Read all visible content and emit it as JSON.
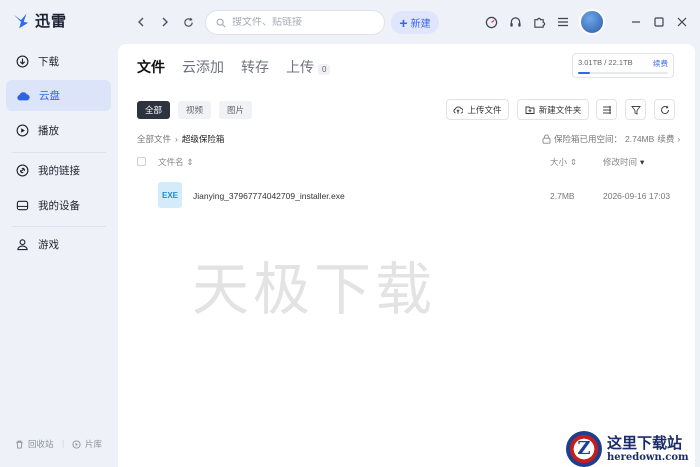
{
  "app": {
    "name": "迅雷"
  },
  "search": {
    "placeholder": "搜文件、贴链接"
  },
  "toolbar": {
    "new_label": "新建"
  },
  "sidebar": {
    "items": [
      {
        "label": "下载",
        "icon": "download-icon"
      },
      {
        "label": "云盘",
        "icon": "cloud-icon"
      },
      {
        "label": "播放",
        "icon": "play-icon"
      },
      {
        "label": "我的链接",
        "icon": "link-icon"
      },
      {
        "label": "我的设备",
        "icon": "device-icon"
      },
      {
        "label": "游戏",
        "icon": "game-icon"
      }
    ],
    "active_index": 1,
    "bottom": {
      "recycle": "回收站",
      "library": "片库"
    }
  },
  "tabs": [
    {
      "label": "文件",
      "active": true
    },
    {
      "label": "云添加"
    },
    {
      "label": "转存"
    },
    {
      "label": "上传",
      "count": "0"
    }
  ],
  "storage": {
    "used_text": "3.01TB / 22.1TB",
    "renew": "续费",
    "used_fraction": 0.136
  },
  "filters": [
    {
      "label": "全部",
      "active": true
    },
    {
      "label": "视频"
    },
    {
      "label": "图片"
    }
  ],
  "actions": {
    "upload": "上传文件",
    "new_folder": "新建文件夹"
  },
  "breadcrumb": {
    "root": "全部文件",
    "current": "超级保险箱"
  },
  "vault": {
    "text": "保险箱已用空间：",
    "used": "2.74MB",
    "renew": "续费"
  },
  "table": {
    "headers": {
      "name": "文件名",
      "size": "大小",
      "modified": "修改时间"
    },
    "rows": [
      {
        "ext": "EXE",
        "name": "Jianying_37967774042709_installer.exe",
        "size": "2.7MB",
        "date": "2026-09-16 17:03"
      }
    ]
  },
  "watermark": "天极下载",
  "site_badge": {
    "cn": "这里下载站",
    "en": "heredown.com",
    "logo_letter": "Z"
  },
  "colors": {
    "accent": "#3a66e6",
    "sidebar_active_bg": "#dbe4f8",
    "app_bg": "#eef1f7"
  }
}
